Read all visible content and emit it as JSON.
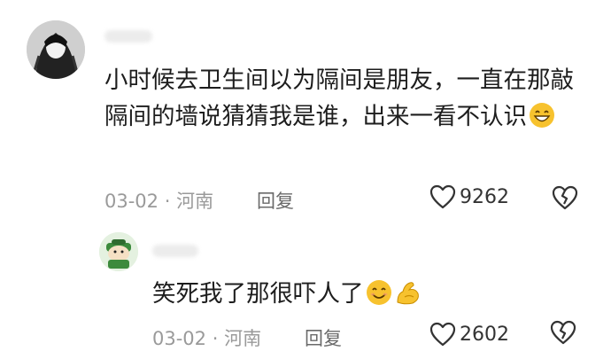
{
  "comments": [
    {
      "text": "小时候去卫生间以为隔间是朋友，一直在那敲隔间的墙说猜猜我是谁，出来一看不认识",
      "emoji": "grinning-face-emoji",
      "date": "03-02",
      "separator": "·",
      "location": "河南",
      "reply_label": "回复",
      "likes": "9262"
    },
    {
      "text": "笑死我了那很吓人了",
      "emoji": [
        "smiling-face-emoji",
        "flexed-biceps-emoji"
      ],
      "date": "03-02",
      "separator": "·",
      "location": "河南",
      "reply_label": "回复",
      "likes": "2602"
    }
  ],
  "icons": [
    "heart-icon",
    "broken-heart-icon"
  ],
  "colors": {
    "meta": "#9a9a9a",
    "text": "#1d1d1d",
    "emoji": "#f7c22e"
  }
}
